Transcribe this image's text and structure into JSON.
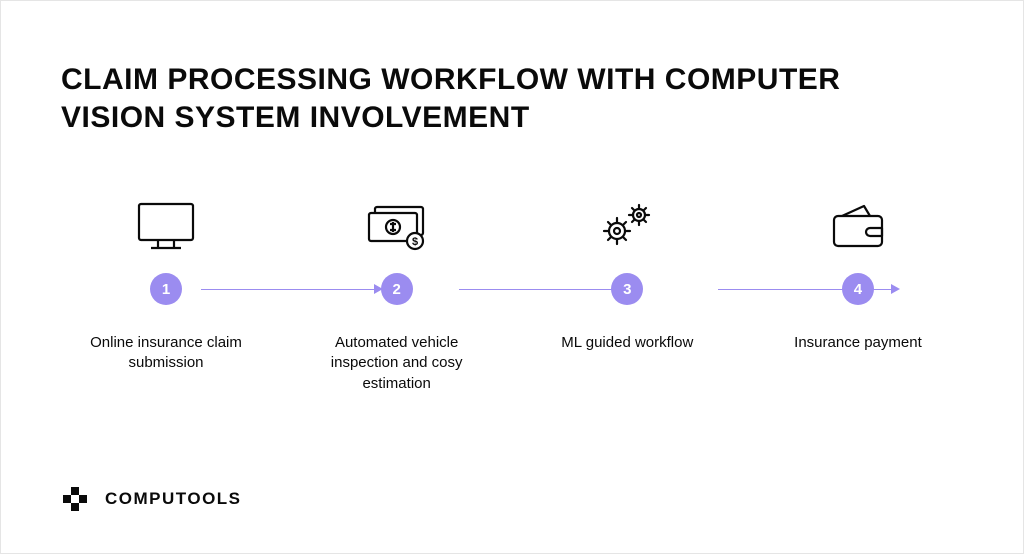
{
  "title": "CLAIM PROCESSING WORKFLOW WITH COMPUTER VISION SYSTEM INVOLVEMENT",
  "steps": [
    {
      "num": "1",
      "label": "Online insurance claim submission",
      "icon": "monitor-icon"
    },
    {
      "num": "2",
      "label": "Automated vehicle inspection and cosy estimation",
      "icon": "money-icon"
    },
    {
      "num": "3",
      "label": "ML guided workflow",
      "icon": "gears-icon"
    },
    {
      "num": "4",
      "label": "Insurance payment",
      "icon": "wallet-icon"
    }
  ],
  "brand": "COMPUTOOLS",
  "colors": {
    "accent": "#9b8cf0",
    "ink": "#0a0a0a"
  }
}
